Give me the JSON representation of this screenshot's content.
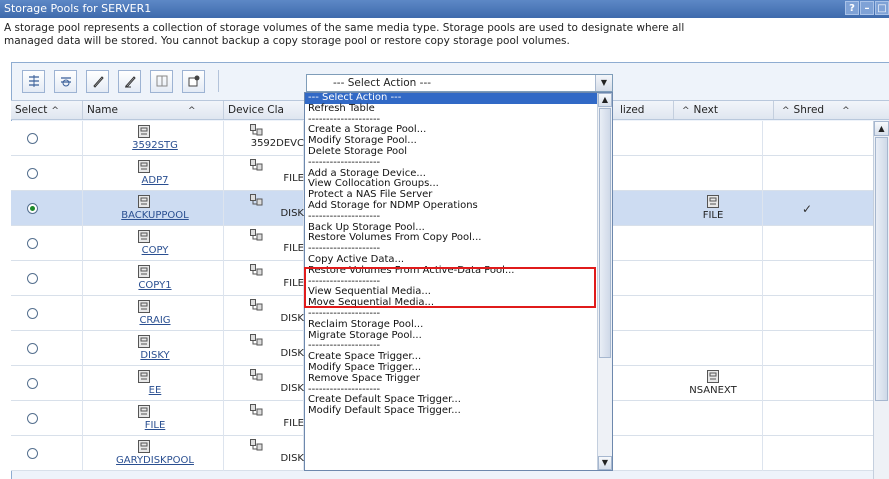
{
  "window": {
    "title": "Storage Pools for SERVER1",
    "controls": [
      "?",
      "–",
      "□"
    ]
  },
  "description": {
    "line1": "A storage pool represents a collection of storage volumes of the same media type. Storage pools are used to designate where all",
    "line2": "managed data will be stored. You cannot backup a copy storage pool or restore copy storage pool volumes."
  },
  "toolbar": {
    "buttons": [
      "select-all-icon",
      "deselect-all-icon",
      "edit-icon",
      "clear-icon",
      "columns-icon",
      "settings-icon"
    ],
    "select_action": "--- Select Action ---"
  },
  "table": {
    "headers": {
      "select": "Select",
      "name": "Name",
      "device_class": "Device Cla",
      "utilized": "lized",
      "next": "Next",
      "shred": "Shred"
    },
    "rows": [
      {
        "name": "3592STG",
        "device": "3592DEVC",
        "next": "",
        "shred": "",
        "selected": false
      },
      {
        "name": "ADP7",
        "device": "FILE",
        "next": "",
        "shred": "",
        "selected": false
      },
      {
        "name": "BACKUPPOOL",
        "device": "DISK",
        "next": "FILE",
        "shred": "✓",
        "selected": true
      },
      {
        "name": "COPY",
        "device": "FILE",
        "next": "",
        "shred": "",
        "selected": false
      },
      {
        "name": "COPY1",
        "device": "FILE",
        "next": "",
        "shred": "",
        "selected": false
      },
      {
        "name": "CRAIG",
        "device": "DISK",
        "next": "",
        "shred": "",
        "selected": false
      },
      {
        "name": "DISKY",
        "device": "DISK",
        "next": "",
        "shred": "",
        "selected": false
      },
      {
        "name": "EE",
        "device": "DISK",
        "next": "NSANEXT",
        "shred": "",
        "selected": false
      },
      {
        "name": "FILE",
        "device": "FILE",
        "next": "",
        "shred": "",
        "selected": false
      },
      {
        "name": "GARYDISKPOOL",
        "device": "DISK",
        "next": "",
        "shred": "",
        "selected": false
      }
    ]
  },
  "dropdown": {
    "items": [
      "--- Select Action ---",
      "Refresh Table",
      "--------------------",
      "Create a Storage Pool...",
      "Modify Storage Pool...",
      "Delete Storage Pool",
      "--------------------",
      "Add a Storage Device...",
      "View Collocation Groups...",
      "Protect a NAS File Server",
      "Add Storage for NDMP Operations",
      "--------------------",
      "Back Up Storage Pool...",
      "Restore Volumes From Copy Pool...",
      "--------------------",
      "Copy Active Data...",
      "Restore Volumes From Active-Data Pool...",
      "--------------------",
      "View Sequential Media...",
      "Move Sequential Media...",
      "--------------------",
      "Reclaim Storage Pool...",
      "Migrate Storage Pool...",
      "--------------------",
      "Create Space Trigger...",
      "Modify Space Trigger...",
      "Remove Space Trigger",
      "--------------------",
      "Create Default Space Trigger...",
      "Modify Default Space Trigger..."
    ],
    "highlighted_index": 0
  },
  "colors": {
    "titlebar": "#3e6aac",
    "selected_row": "#cddcf2",
    "highlight": "#3169c6",
    "callout": "#e01b1b"
  }
}
